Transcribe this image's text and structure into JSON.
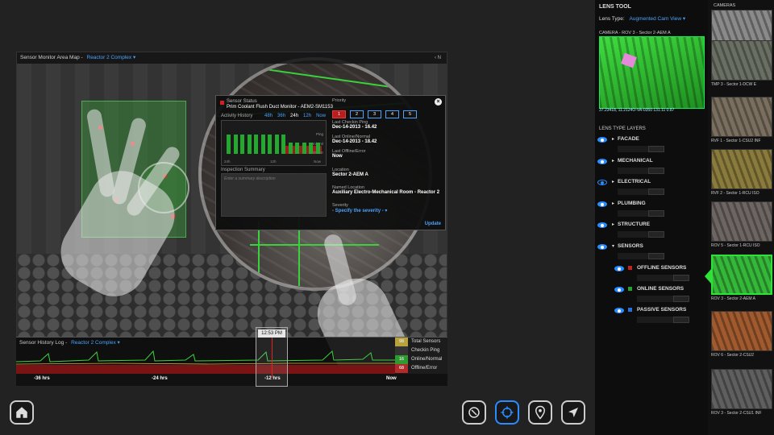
{
  "map": {
    "title": "Sensor Monitor Area Map -",
    "area_link": "Reactor 2 Complex ▾",
    "north": "‹ N"
  },
  "popup": {
    "status_label": "Sensor Status",
    "sensor_name": "Prim Coolant Flush Duct Monitor - AEM2-SM1153",
    "activity_label": "Activity History",
    "ranges": [
      "48h",
      "36h",
      "24h",
      "12h",
      "Now"
    ],
    "selected_range": "24h",
    "levels": [
      "Ping",
      "On/Nml",
      "Off/Err"
    ],
    "chart_axis": [
      "24h",
      "12h",
      "Now"
    ],
    "inspection_label": "Inspection Summary",
    "inspection_placeholder": "Enter a summary description",
    "priority_label": "Priority",
    "priority_options": [
      "1",
      "2",
      "3",
      "4",
      "5"
    ],
    "priority_selected": "1",
    "last_ping_label": "Last Checkin Ping",
    "last_ping_value": "Dec-14-2013 - 16.42",
    "last_online_label": "Last Online/Normal",
    "last_online_value": "Dec-14-2013 - 18.42",
    "last_offline_label": "Last Offline/Error",
    "last_offline_value": "Now",
    "location_label": "Location",
    "location_value": "Sector 2-AEM A",
    "named_location_label": "Named Location",
    "named_location_value": "Auxiliary Electro-Mechanical Room - Reactor 2",
    "severity_label": "Severity",
    "severity_value": "- Specify the severity - ▾",
    "update_label": "Update",
    "colors": {
      "online": "#25a830",
      "error": "#9a1d1d",
      "link": "#4aa3ff"
    }
  },
  "history": {
    "title": "Sensor History Log -",
    "area_link": "Reactor 2 Complex ▾",
    "scrub_time": "12:53 PM",
    "axis": [
      "-36 hrs",
      "-24 hrs",
      "-12 hrs",
      "Now"
    ],
    "legend": [
      {
        "count": "98",
        "label": "Total Sensors",
        "color": "#b9a23a"
      },
      {
        "count": "",
        "label": "Checkin Ping",
        "color": "#333333"
      },
      {
        "count": "16",
        "label": "Online/Normal",
        "color": "#2e9b2e"
      },
      {
        "count": "68",
        "label": "Offline/Error",
        "color": "#b22a2a"
      }
    ]
  },
  "toolbar": {
    "home": "home-icon",
    "compass": "compass-icon",
    "target": "crosshair-icon",
    "pin": "map-pin-icon",
    "navigate": "navigation-arrow-icon"
  },
  "panel": {
    "title": "LENS TOOL",
    "lens_type_label": "Lens Type:",
    "lens_type_value": "Augmented Cam View ▾",
    "camera_label": "CAMERA - ROV 3 - Sector 2-AEM A",
    "camera_coords": "37.23418, 11.2124O-VA-0350 131.11 0.87",
    "layers_label": "LENS TYPE LAYERS",
    "layers": [
      {
        "name": "FACADE",
        "visible": true,
        "expanded": false
      },
      {
        "name": "MECHANICAL",
        "visible": true,
        "expanded": false
      },
      {
        "name": "ELECTRICAL",
        "visible": false,
        "expanded": false
      },
      {
        "name": "PLUMBING",
        "visible": true,
        "expanded": false
      },
      {
        "name": "STRUCTURE",
        "visible": true,
        "expanded": false
      },
      {
        "name": "SENSORS",
        "visible": true,
        "expanded": true
      }
    ],
    "sublayers": [
      {
        "name": "OFFLINE SENSORS",
        "color": "#c62020"
      },
      {
        "name": "ONLINE SENSORS",
        "color": "#23a32d"
      },
      {
        "name": "PASSIVE SENSORS",
        "color": "#2a6fe0"
      }
    ]
  },
  "cameras": {
    "title": "CAMERAS",
    "items": [
      {
        "caption": "RFV 4 - Sector 1-EXTCU 2",
        "active": false,
        "color": "#8a8a8a"
      },
      {
        "caption": "TMP 3 - Sector 1-DCW E",
        "active": false,
        "color": "#6a6f63"
      },
      {
        "caption": "RVF 1 - Sector 1-CSU2 INF",
        "active": false,
        "color": "#7a6e5e"
      },
      {
        "caption": "RVF 2 - Sector 1-RCU ISO",
        "active": false,
        "color": "#8a7b3c"
      },
      {
        "caption": "ROV 5 - Sector 1-RCU ISO",
        "active": false,
        "color": "#6d6562"
      },
      {
        "caption": "ROV 3 - Sector 2-AEM A",
        "active": true,
        "color": "#35b83a"
      },
      {
        "caption": "ROV 6 - Sector 2-CSU2",
        "active": false,
        "color": "#a05a2e"
      },
      {
        "caption": "ROV 3 - Sector 2-CSU1 INF",
        "active": false,
        "color": "#5f5f5f"
      }
    ]
  }
}
